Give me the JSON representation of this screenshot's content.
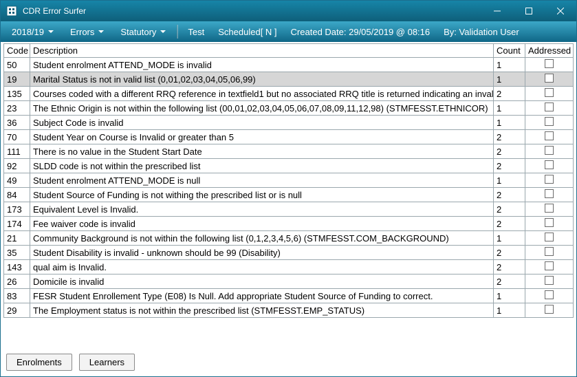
{
  "window": {
    "title": "CDR Error Surfer"
  },
  "menubar": {
    "year": "2018/19",
    "errors": "Errors",
    "statutory": "Statutory",
    "test": "Test",
    "scheduled": "Scheduled[ N ]",
    "created_label": "Created Date:",
    "created_value": "29/05/2019 @ 08:16",
    "by_label": "By:",
    "by_value": "Validation User"
  },
  "columns": {
    "code": "Code",
    "description": "Description",
    "count": "Count",
    "addressed": "Addressed"
  },
  "rows": [
    {
      "code": "50",
      "desc": "Student enrolment ATTEND_MODE is invalid",
      "count": "1",
      "selected": false
    },
    {
      "code": "19",
      "desc": "Marital Status is not in valid list (0,01,02,03,04,05,06,99)",
      "count": "1",
      "selected": true
    },
    {
      "code": "135",
      "desc": "Courses coded with a different RRQ reference in textfield1 but no associated RRQ title is returned indicating an invalid RRQ reference",
      "count": "2",
      "selected": false
    },
    {
      "code": "23",
      "desc": "The Ethnic Origin is not within the following list (00,01,02,03,04,05,06,07,08,09,11,12,98) (STMFESST.ETHNICOR)",
      "count": "1",
      "selected": false
    },
    {
      "code": "36",
      "desc": "Subject Code is invalid",
      "count": "1",
      "selected": false
    },
    {
      "code": "70",
      "desc": "Student Year on Course is Invalid or greater than 5",
      "count": "2",
      "selected": false
    },
    {
      "code": "111",
      "desc": "There is no value in the Student Start Date",
      "count": "2",
      "selected": false
    },
    {
      "code": "92",
      "desc": "SLDD code is not within the prescribed list",
      "count": "2",
      "selected": false
    },
    {
      "code": "49",
      "desc": "Student enrolment ATTEND_MODE is null",
      "count": "1",
      "selected": false
    },
    {
      "code": "84",
      "desc": "Student Source of Funding is not withing the prescribed list or is null",
      "count": "2",
      "selected": false
    },
    {
      "code": "173",
      "desc": "Equivalent Level is Invalid.",
      "count": "2",
      "selected": false
    },
    {
      "code": "174",
      "desc": "Fee waiver code is invalid",
      "count": "2",
      "selected": false
    },
    {
      "code": "21",
      "desc": "Community Background is not within the following list (0,1,2,3,4,5,6) (STMFESST.COM_BACKGROUND)",
      "count": "1",
      "selected": false
    },
    {
      "code": "35",
      "desc": "Student Disability is invalid - unknown should be 99  (Disability)",
      "count": "2",
      "selected": false
    },
    {
      "code": "143",
      "desc": "qual aim is Invalid.",
      "count": "2",
      "selected": false
    },
    {
      "code": "26",
      "desc": "Domicile is invalid",
      "count": "2",
      "selected": false
    },
    {
      "code": "83",
      "desc": "FESR Student Enrollement Type (E08) Is Null.  Add appropriate Student Source of Funding to correct.",
      "count": "1",
      "selected": false
    },
    {
      "code": "29",
      "desc": "The Employment status is not within the prescribed list  (STMFESST.EMP_STATUS)",
      "count": "1",
      "selected": false
    }
  ],
  "footer": {
    "enrolments": "Enrolments",
    "learners": "Learners"
  }
}
